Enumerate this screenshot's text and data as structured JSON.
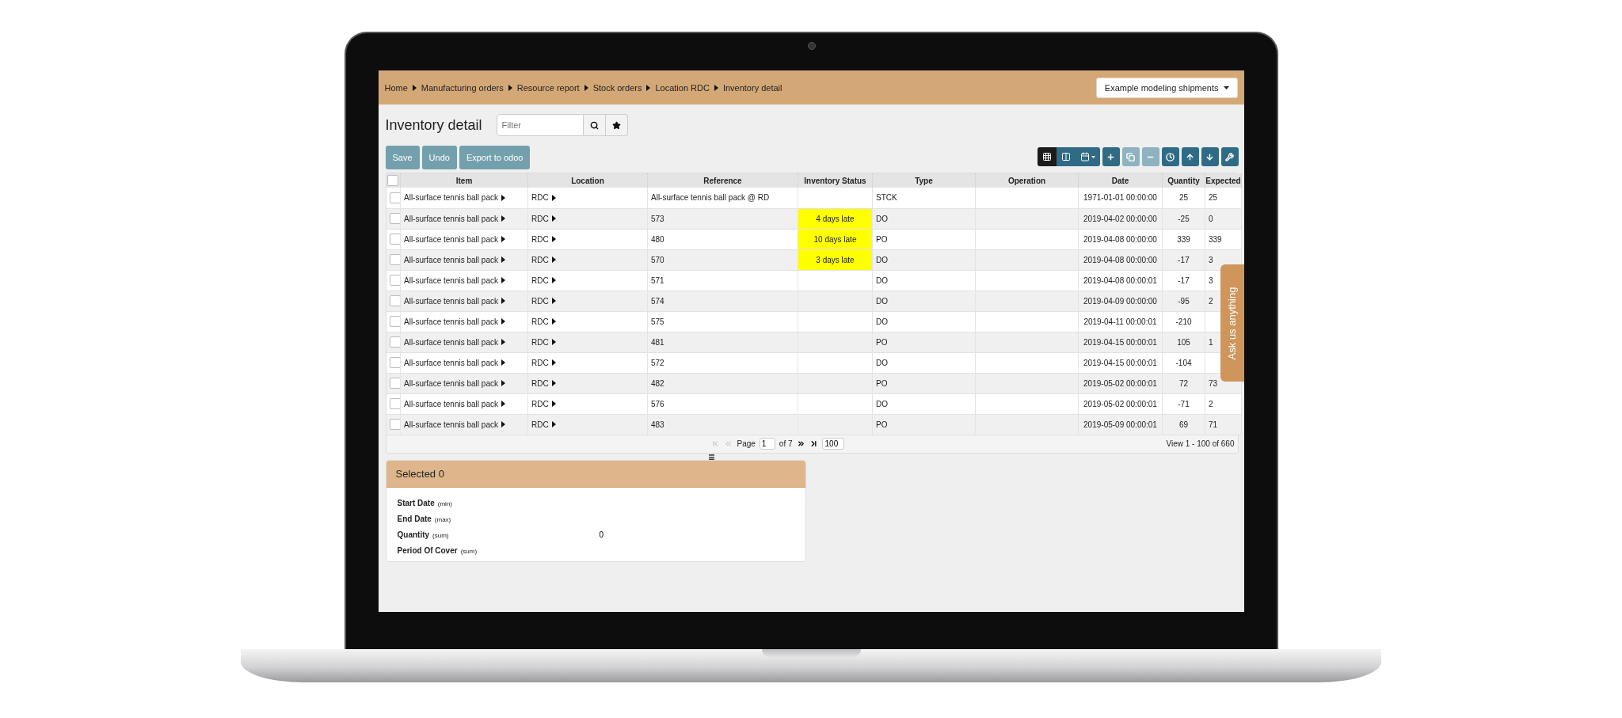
{
  "breadcrumbs": [
    "Home",
    "Manufacturing orders",
    "Resource report",
    "Stock orders",
    "Location RDC",
    "Inventory detail"
  ],
  "scenario_menu": {
    "label": "Example modeling shipments"
  },
  "page_title": "Inventory detail",
  "filter": {
    "placeholder": "Filter"
  },
  "actions": [
    "Save",
    "Undo",
    "Export to odoo"
  ],
  "view_modes": [
    {
      "kind": "grid",
      "selected": true
    },
    {
      "kind": "columns",
      "selected": false
    },
    {
      "kind": "calendar",
      "selected": false
    }
  ],
  "tools": [
    {
      "kind": "add",
      "disabled": false
    },
    {
      "kind": "copy",
      "disabled": true
    },
    {
      "kind": "delete",
      "disabled": true
    },
    {
      "kind": "clock",
      "disabled": false
    },
    {
      "kind": "up",
      "disabled": false
    },
    {
      "kind": "down",
      "disabled": false
    },
    {
      "kind": "wrench",
      "disabled": false
    }
  ],
  "table": {
    "header_checked": false,
    "columns": [
      "Item",
      "Location",
      "Reference",
      "Inventory Status",
      "Type",
      "Operation",
      "Date",
      "Quantity",
      "Expected"
    ],
    "rows": [
      {
        "checked": false,
        "item": "All-surface tennis ball pack",
        "location": "RDC",
        "reference": "All-surface tennis ball pack @ RD",
        "type": "STCK",
        "date": "1971-01-01 00:00:00",
        "quantity": "25",
        "expected": "25"
      },
      {
        "checked": false,
        "item": "All-surface tennis ball pack",
        "location": "RDC",
        "reference": "573",
        "status": "4 days late",
        "type": "DO",
        "date": "2019-04-02 00:00:00",
        "quantity": "-25",
        "expected": "0"
      },
      {
        "checked": false,
        "item": "All-surface tennis ball pack",
        "location": "RDC",
        "reference": "480",
        "status": "10 days late",
        "type": "PO",
        "date": "2019-04-08 00:00:00",
        "quantity": "339",
        "expected": "339"
      },
      {
        "checked": false,
        "item": "All-surface tennis ball pack",
        "location": "RDC",
        "reference": "570",
        "status": "3 days late",
        "type": "DO",
        "date": "2019-04-08 00:00:00",
        "quantity": "-17",
        "expected": "3"
      },
      {
        "checked": false,
        "item": "All-surface tennis ball pack",
        "location": "RDC",
        "reference": "571",
        "type": "DO",
        "date": "2019-04-08 00:00:01",
        "quantity": "-17",
        "expected": "3"
      },
      {
        "checked": false,
        "item": "All-surface tennis ball pack",
        "location": "RDC",
        "reference": "574",
        "type": "DO",
        "date": "2019-04-09 00:00:00",
        "quantity": "-95",
        "expected": "2"
      },
      {
        "checked": false,
        "item": "All-surface tennis ball pack",
        "location": "RDC",
        "reference": "575",
        "type": "DO",
        "date": "2019-04-11 00:00:01",
        "quantity": "-210"
      },
      {
        "checked": false,
        "item": "All-surface tennis ball pack",
        "location": "RDC",
        "reference": "481",
        "type": "PO",
        "date": "2019-04-15 00:00:01",
        "quantity": "105",
        "expected": "1"
      },
      {
        "checked": false,
        "item": "All-surface tennis ball pack",
        "location": "RDC",
        "reference": "572",
        "type": "DO",
        "date": "2019-04-15 00:00:01",
        "quantity": "-104"
      },
      {
        "checked": false,
        "item": "All-surface tennis ball pack",
        "location": "RDC",
        "reference": "482",
        "type": "PO",
        "date": "2019-05-02 00:00:01",
        "quantity": "72",
        "expected": "73"
      },
      {
        "checked": false,
        "item": "All-surface tennis ball pack",
        "location": "RDC",
        "reference": "576",
        "type": "DO",
        "date": "2019-05-02 00:00:01",
        "quantity": "-71",
        "expected": "2"
      },
      {
        "checked": false,
        "item": "All-surface tennis ball pack",
        "location": "RDC",
        "reference": "483",
        "type": "PO",
        "date": "2019-05-09 00:00:01",
        "quantity": "69",
        "expected": "71"
      }
    ]
  },
  "pagination": {
    "prev_disabled": true,
    "next_disabled": false,
    "label": "Page",
    "page": "1",
    "of": "of 7",
    "page_size": "100",
    "summary": "View 1 - 100 of 660"
  },
  "summary_panel": {
    "title": "Selected 0",
    "fields": [
      {
        "label": "Start Date",
        "hint": "(min)"
      },
      {
        "label": "End Date",
        "hint": "(max)"
      },
      {
        "label": "Quantity",
        "hint": "(sum)",
        "value": "0"
      },
      {
        "label": "Period Of Cover",
        "hint": "(sum)"
      }
    ]
  },
  "help_tab": {
    "label": "Ask us anything"
  }
}
